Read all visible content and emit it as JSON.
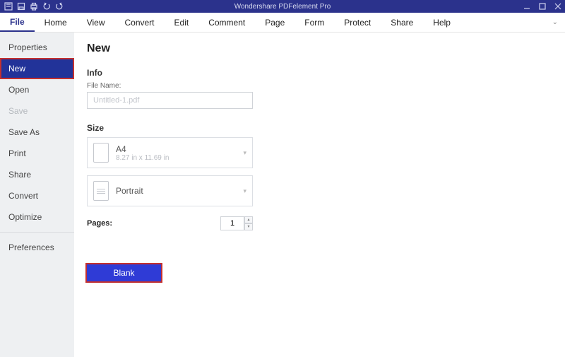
{
  "app": {
    "title": "Wondershare PDFelement Pro"
  },
  "menubar": {
    "items": [
      "File",
      "Home",
      "View",
      "Convert",
      "Edit",
      "Comment",
      "Page",
      "Form",
      "Protect",
      "Share",
      "Help"
    ],
    "active": "File"
  },
  "sidebar": {
    "items": [
      {
        "label": "Properties",
        "state": "normal"
      },
      {
        "label": "New",
        "state": "active"
      },
      {
        "label": "Open",
        "state": "normal"
      },
      {
        "label": "Save",
        "state": "disabled"
      },
      {
        "label": "Save As",
        "state": "normal"
      },
      {
        "label": "Print",
        "state": "normal"
      },
      {
        "label": "Share",
        "state": "normal"
      },
      {
        "label": "Convert",
        "state": "normal"
      },
      {
        "label": "Optimize",
        "state": "normal"
      }
    ],
    "footer": {
      "label": "Preferences"
    }
  },
  "main": {
    "heading": "New",
    "info": {
      "section": "Info",
      "filename_label": "File Name:",
      "filename_placeholder": "Untitled-1.pdf",
      "filename_value": ""
    },
    "size": {
      "section": "Size",
      "paper": {
        "name": "A4",
        "dims": "8.27 in x 11.69 in"
      },
      "orientation": {
        "name": "Portrait"
      }
    },
    "pages": {
      "label": "Pages:",
      "value": "1"
    },
    "blank_button": "Blank"
  }
}
